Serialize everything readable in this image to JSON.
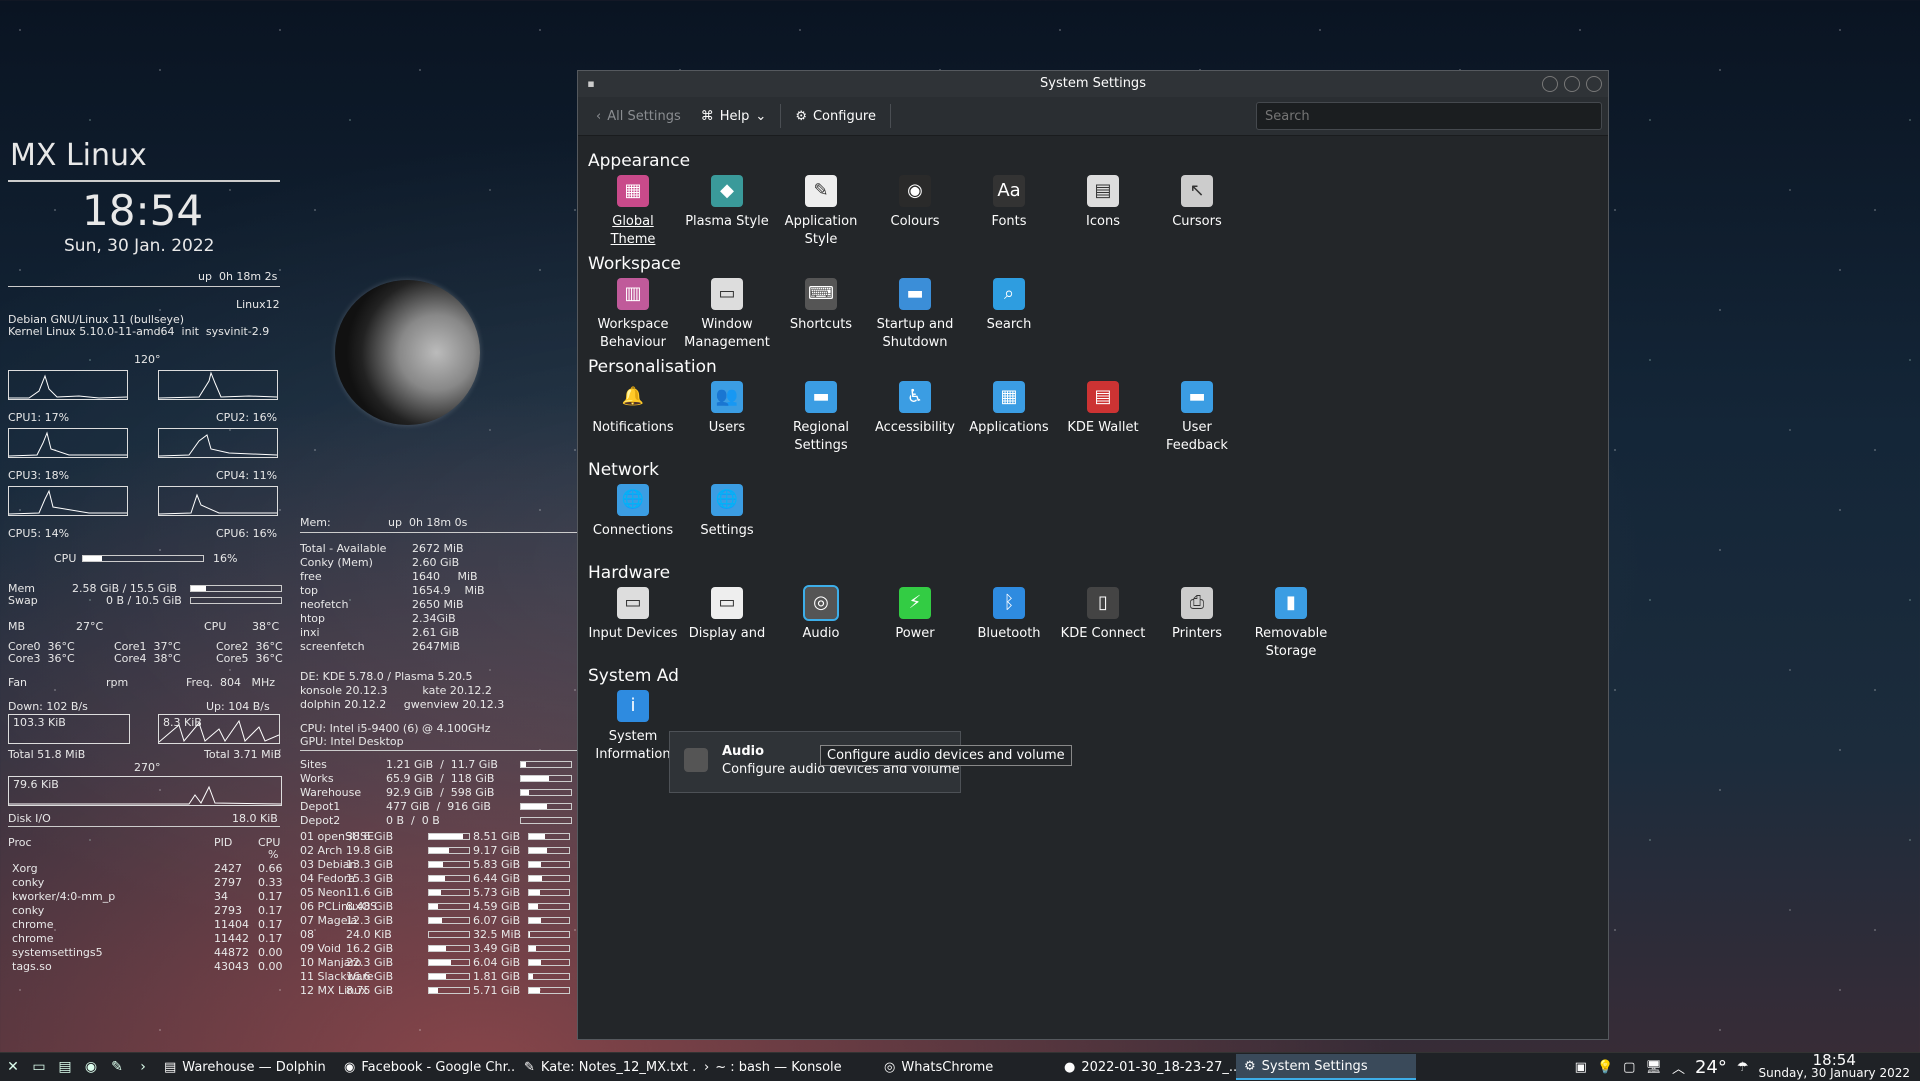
{
  "conky": {
    "title": "MX Linux",
    "time": "18:54",
    "date": "Sun, 30 Jan. 2022",
    "uptime": "up  0h 18m 2s",
    "host": "Linux12",
    "os": "Debian GNU/Linux 11 (bullseye)",
    "kernel": "Kernel Linux 5.10.0-11-amd64  init  sysvinit-2.9",
    "deg120": "120°",
    "cpu1": "CPU1: 17%",
    "cpu2": "CPU2: 16%",
    "cpu3": "CPU3: 18%",
    "cpu4": "CPU4: 11%",
    "cpu5": "CPU5: 14%",
    "cpu6": "CPU6: 16%",
    "cpu_label": "CPU",
    "cpu_total": "16%",
    "cpu_total_fraction": 0.16,
    "mem_label": "Mem",
    "mem_value": "2.58 GiB / 15.5 GiB",
    "mem_fraction": 0.17,
    "swap_label": "Swap",
    "swap_value": "0 B / 10.5 GiB",
    "swap_fraction": 0.0,
    "mb": "MB",
    "mb_temp": "27°C",
    "cpu_t": "CPU",
    "cpu_temp": "38°C",
    "cores_row1": [
      "Core0  36°C",
      "Core1  37°C",
      "Core2  36°C"
    ],
    "cores_row2": [
      "Core3  36°C",
      "Core4  38°C",
      "Core5  36°C"
    ],
    "fan": "Fan",
    "rpm": "rpm",
    "freq": "Freq.  804   MHz",
    "down": "Down: 102 B/s",
    "up": "Up: 104 B/s",
    "down_box": "103.3 KiB",
    "up_box": "8.3 KiB",
    "total_down": "Total 51.8 MiB",
    "total_up": "Total 3.71 MiB",
    "deg270": "270°",
    "disk_box": "79.6 KiB",
    "disk_io": "Disk I/O",
    "disk_io_val": "18.0 KiB",
    "proc_hdr": [
      "Proc",
      "PID",
      "CPU"
    ],
    "proc_pct": "%",
    "procs": [
      [
        "Xorg",
        "2427",
        "0.66"
      ],
      [
        "conky",
        "2797",
        "0.33"
      ],
      [
        "kworker/4:0-mm_p",
        "34",
        "0.17"
      ],
      [
        "conky",
        "2793",
        "0.17"
      ],
      [
        "chrome",
        "11404",
        "0.17"
      ],
      [
        "chrome",
        "11442",
        "0.17"
      ],
      [
        "systemsettings5",
        "44872",
        "0.00"
      ],
      [
        "tags.so",
        "43043",
        "0.00"
      ]
    ],
    "mem2_label": "Mem:",
    "mem2_up": "up  0h 18m 0s",
    "mem_table": [
      [
        "Total - Available",
        "2672 MiB"
      ],
      [
        "Conky (Mem)",
        "2.60 GiB"
      ],
      [
        "free",
        "1640     MiB"
      ],
      [
        "top",
        "1654.9    MiB"
      ],
      [
        "neofetch",
        "2650 MiB"
      ],
      [
        "htop",
        "2.34GiB"
      ],
      [
        "inxi",
        "2.61 GiB"
      ],
      [
        "screenfetch",
        "2647MiB"
      ]
    ],
    "de": "DE: KDE 5.78.0 / Plasma 5.20.5",
    "konsole": "konsole 20.12.3          kate 20.12.2",
    "dolphin": "dolphin 20.12.2     gwenview 20.12.3",
    "cpu_model": "CPU: Intel i5-9400 (6) @ 4.100GHz",
    "gpu": "GPU: Intel Desktop",
    "sites": [
      [
        "Sites",
        "1.21 GiB  /  11.7 GiB",
        0.1
      ],
      [
        "Works",
        "65.9 GiB  /  118 GiB",
        0.56
      ],
      [
        "Warehouse",
        "92.9 GiB  /  598 GiB",
        0.16
      ],
      [
        "Depot1",
        "477 GiB  /  916 GiB",
        0.52
      ],
      [
        "Depot2",
        "0 B  /  0 B",
        0.0
      ]
    ],
    "distros": [
      [
        "01 openSUSE",
        "38.6 GiB",
        0.85,
        "8.51 GiB",
        0.4
      ],
      [
        "02 Arch",
        "19.8 GiB",
        0.5,
        "9.17 GiB",
        0.45
      ],
      [
        "03 Debian",
        "13.3 GiB",
        0.35,
        "5.83 GiB",
        0.3
      ],
      [
        "04 Fedora",
        "15.3 GiB",
        0.4,
        "6.44 GiB",
        0.32
      ],
      [
        "05 Neon",
        "11.6 GiB",
        0.3,
        "5.73 GiB",
        0.28
      ],
      [
        "06 PCLinuxOS",
        "8.48 GiB",
        0.22,
        "4.59 GiB",
        0.22
      ],
      [
        "07 Mageia",
        "12.3 GiB",
        0.32,
        "6.07 GiB",
        0.3
      ],
      [
        "08",
        "24.0 KiB",
        0.0,
        "32.5 MiB",
        0.02
      ],
      [
        "09 Void",
        "16.2 GiB",
        0.42,
        "3.49 GiB",
        0.18
      ],
      [
        "10 Manjaro",
        "22.3 GiB",
        0.55,
        "6.04 GiB",
        0.3
      ],
      [
        "11 Slackware",
        "16.6 GiB",
        0.43,
        "1.81 GiB",
        0.1
      ],
      [
        "12 MX Linux",
        "8.75 GiB",
        0.23,
        "5.71 GiB",
        0.28
      ]
    ]
  },
  "window": {
    "title": "System Settings",
    "toolbar": {
      "back": "All Settings",
      "help": "Help",
      "configure": "Configure",
      "search_placeholder": "Search"
    },
    "sections": [
      {
        "title": "Appearance",
        "items": [
          "Global Theme",
          "Plasma Style",
          "Application Style",
          "Colours",
          "Fonts",
          "Icons",
          "Cursors"
        ]
      },
      {
        "title": "Workspace",
        "items": [
          "Workspace Behaviour",
          "Window Management",
          "Shortcuts",
          "Startup and Shutdown",
          "Search"
        ]
      },
      {
        "title": "Personalisation",
        "items": [
          "Notifications",
          "Users",
          "Regional Settings",
          "Accessibility",
          "Applications",
          "KDE Wallet",
          "User Feedback"
        ]
      },
      {
        "title": "Network",
        "items": [
          "Connections",
          "Settings"
        ]
      },
      {
        "title": "Hardware",
        "items": [
          "Input Devices",
          "Display and",
          "Audio",
          "Power",
          "Bluetooth",
          "KDE Connect",
          "Printers",
          "Removable Storage"
        ]
      },
      {
        "title": "System Ad",
        "items": [
          "System Information"
        ]
      }
    ],
    "tooltip": {
      "title": "Audio",
      "desc": "Configure audio devices and volume",
      "hover_text": "Configure audio devices and volume"
    }
  },
  "taskbar": {
    "tasks": [
      "Warehouse — Dolphin",
      "Facebook - Google Chr...",
      "Kate: Notes_12_MX.txt ...",
      "~ : bash — Konsole",
      "WhatsChrome",
      "2022-01-30_18-23-27_...",
      "System Settings"
    ],
    "temp": "24°",
    "time": "18:54",
    "date": "Sunday, 30 January 2022"
  }
}
